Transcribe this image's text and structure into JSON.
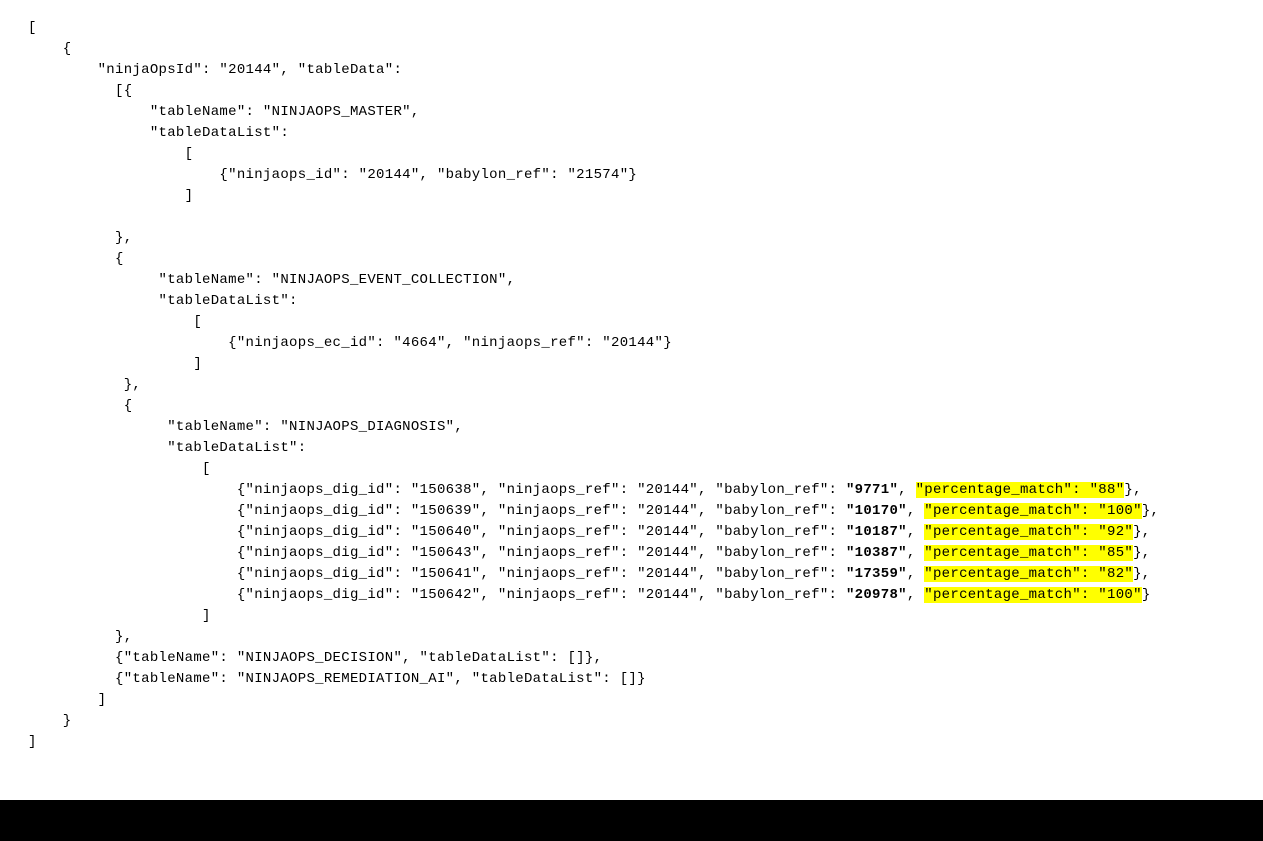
{
  "root": {
    "ninjaOpsId": "20144",
    "tableData_label": "tableData",
    "tables": [
      {
        "tableName": "NINJAOPS_MASTER",
        "rows": [
          {
            "ninjaops_id": "20144",
            "babylon_ref": "21574"
          }
        ]
      },
      {
        "tableName": "NINJAOPS_EVENT_COLLECTION",
        "rows": [
          {
            "ninjaops_ec_id": "4664",
            "ninjaops_ref": "20144"
          }
        ]
      },
      {
        "tableName": "NINJAOPS_DIAGNOSIS",
        "rows": [
          {
            "ninjaops_dig_id": "150638",
            "ninjaops_ref": "20144",
            "babylon_ref": "9771",
            "percentage_match": "88"
          },
          {
            "ninjaops_dig_id": "150639",
            "ninjaops_ref": "20144",
            "babylon_ref": "10170",
            "percentage_match": "100"
          },
          {
            "ninjaops_dig_id": "150640",
            "ninjaops_ref": "20144",
            "babylon_ref": "10187",
            "percentage_match": "92"
          },
          {
            "ninjaops_dig_id": "150643",
            "ninjaops_ref": "20144",
            "babylon_ref": "10387",
            "percentage_match": "85"
          },
          {
            "ninjaops_dig_id": "150641",
            "ninjaops_ref": "20144",
            "babylon_ref": "17359",
            "percentage_match": "82"
          },
          {
            "ninjaops_dig_id": "150642",
            "ninjaops_ref": "20144",
            "babylon_ref": "20978",
            "percentage_match": "100"
          }
        ]
      },
      {
        "tableName": "NINJAOPS_DECISION",
        "rows": []
      },
      {
        "tableName": "NINJAOPS_REMEDIATION_AI",
        "rows": []
      }
    ]
  }
}
